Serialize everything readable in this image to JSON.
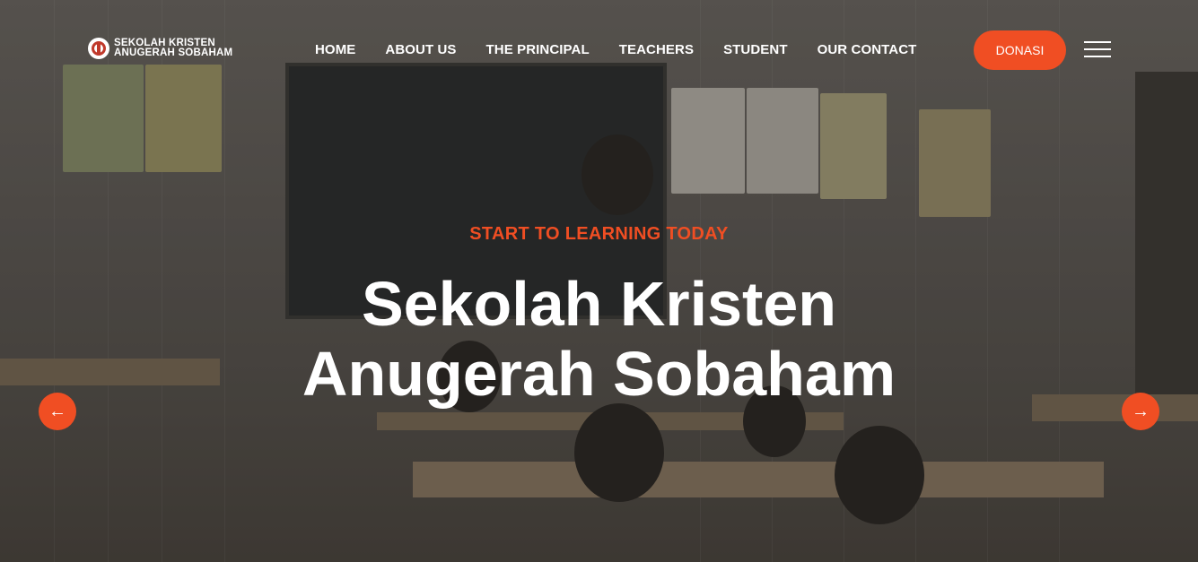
{
  "header": {
    "logo_line1": "SEKOLAH KRISTEN",
    "logo_line2": "ANUGERAH SOBAHAM",
    "nav": [
      "HOME",
      "ABOUT US",
      "THE PRINCIPAL",
      "TEACHERS",
      "STUDENT",
      "OUR CONTACT"
    ],
    "donate_label": "DONASI"
  },
  "hero": {
    "subtitle": "START TO LEARNING TODAY",
    "title_line1": "Sekolah Kristen",
    "title_line2": "Anugerah Sobaham",
    "prev_icon": "arrow-left-icon",
    "next_icon": "arrow-right-icon"
  },
  "colors": {
    "accent": "#f04e23",
    "text": "#ffffff"
  }
}
